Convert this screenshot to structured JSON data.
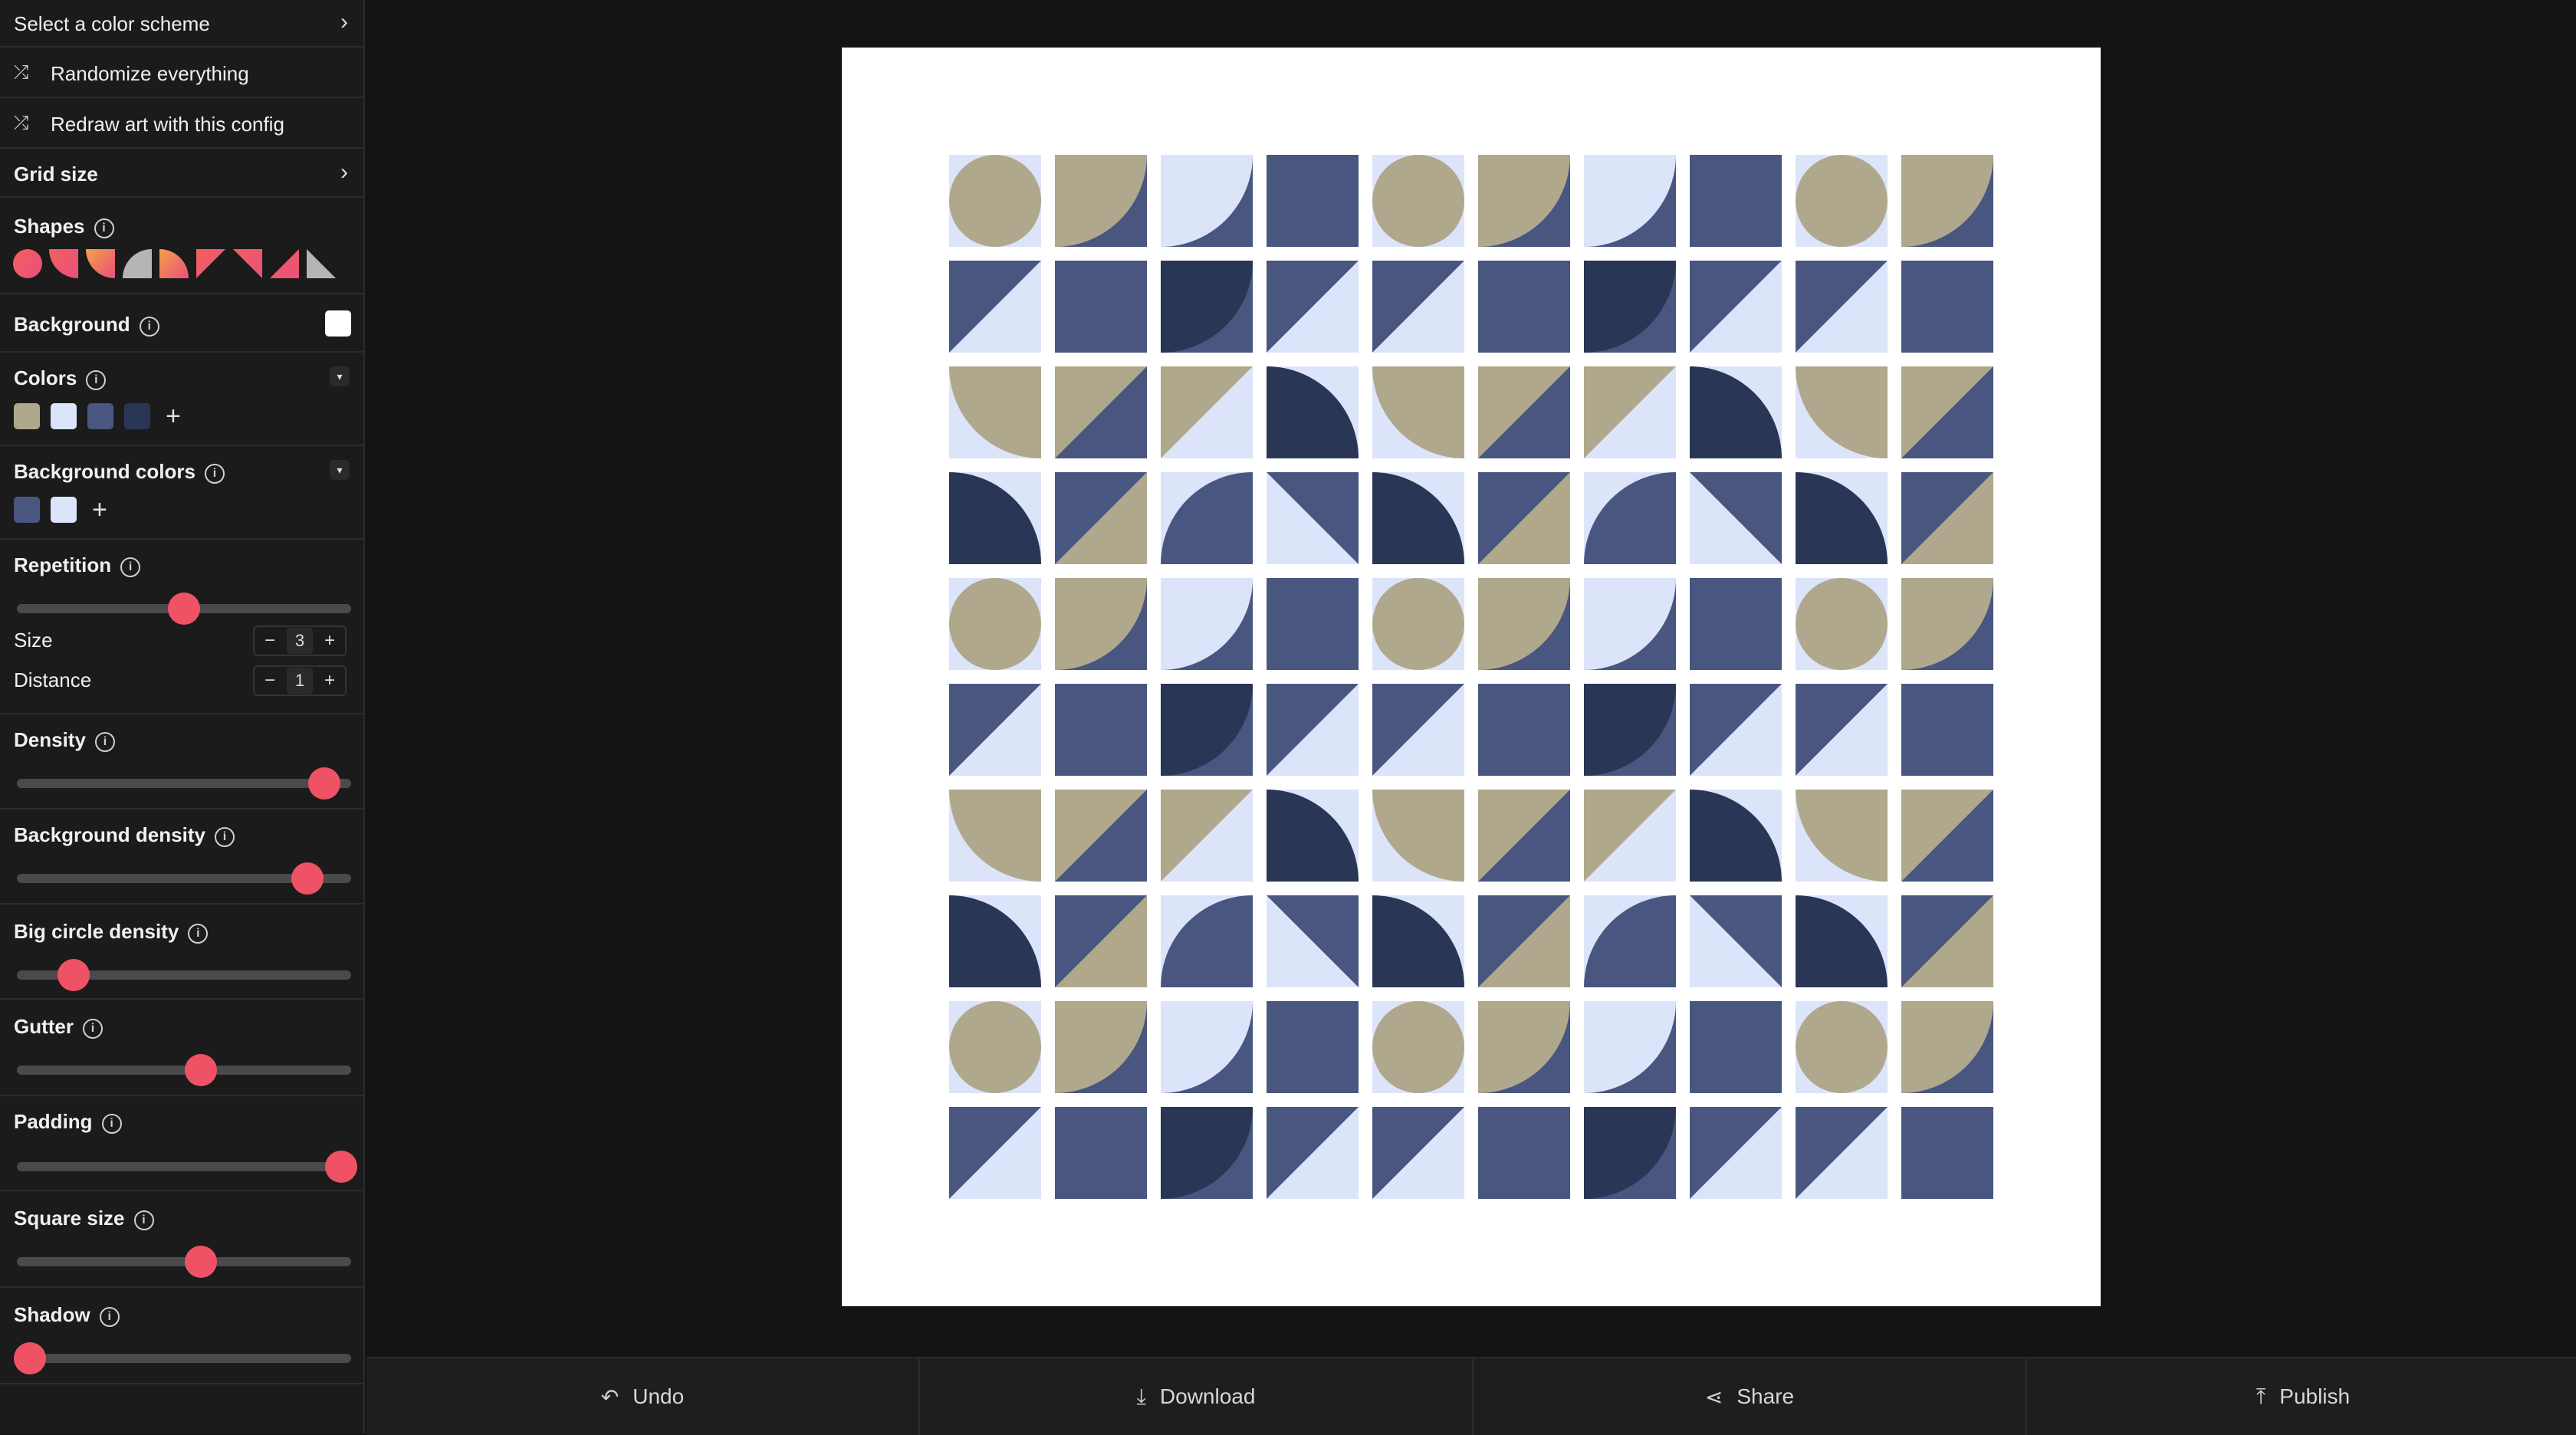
{
  "sidebar": {
    "color_scheme_label": "Select a color scheme",
    "randomize_label": "Randomize everything",
    "redraw_label": "Redraw art with this config",
    "grid_size_label": "Grid size",
    "shapes_label": "Shapes",
    "background_label": "Background",
    "background_color": "#ffffff",
    "colors_label": "Colors",
    "colors": [
      "#b0a88c",
      "#dce4fa",
      "#485680",
      "#2a3656"
    ],
    "background_colors_label": "Background colors",
    "background_colors": [
      "#485680",
      "#dce4fa"
    ],
    "repetition_label": "Repetition",
    "repetition_value": 0.5,
    "size_label": "Size",
    "size_value": "3",
    "distance_label": "Distance",
    "distance_value": "1",
    "density_label": "Density",
    "density_value": 0.92,
    "background_density_label": "Background density",
    "background_density_value": 0.87,
    "big_circle_density_label": "Big circle density",
    "big_circle_density_value": 0.17,
    "gutter_label": "Gutter",
    "gutter_value": 0.55,
    "padding_label": "Padding",
    "padding_value": 0.97,
    "square_size_label": "Square size",
    "square_size_value": 0.55,
    "shadow_label": "Shadow",
    "shadow_value": 0.04,
    "accent_color": "#ef5265"
  },
  "bottom_bar": {
    "undo_label": "Undo",
    "download_label": "Download",
    "share_label": "Share",
    "publish_label": "Publish"
  },
  "art": {
    "palette": {
      "tan": "#b0a88c",
      "light": "#dce4fa",
      "mid": "#485680",
      "dark": "#2a3656"
    },
    "rows": [
      [
        "circle-tan-on-light",
        "q-tan-on-mid-tl",
        "q-light-on-mid-tl",
        "solid-mid",
        "circle-tan-on-light",
        "q-tan-on-mid-tl",
        "q-light-on-mid-tl",
        "solid-mid",
        "circle-tan-on-light",
        "q-tan-on-mid-tl"
      ],
      [
        "tri-mid-on-light",
        "solid-mid",
        "q-dark-on-mid-tl",
        "tri-mid-on-light",
        "tri-mid-on-light",
        "solid-mid",
        "q-dark-on-mid-tl",
        "tri-mid-on-light",
        "tri-mid-on-light",
        "solid-mid"
      ],
      [
        "q-tan-on-light-tr",
        "tri-tan-on-mid",
        "tri-tan-on-light",
        "q-dark-on-light-bl",
        "q-tan-on-light-tr",
        "tri-tan-on-mid",
        "tri-tan-on-light",
        "q-dark-on-light-bl",
        "q-tan-on-light-tr",
        "tri-tan-on-mid"
      ],
      [
        "q-dark-on-light-bl",
        "tri-mid-on-tan",
        "q-mid-on-light-br",
        "tri2-mid-on-light",
        "q-dark-on-light-bl",
        "tri-mid-on-tan",
        "q-mid-on-light-br",
        "tri2-mid-on-light",
        "q-dark-on-light-bl",
        "tri-mid-on-tan"
      ],
      [
        "circle-tan-on-light",
        "q-tan-on-mid-tl",
        "q-light-on-mid-tl",
        "solid-mid",
        "circle-tan-on-light",
        "q-tan-on-mid-tl",
        "q-light-on-mid-tl",
        "solid-mid",
        "circle-tan-on-light",
        "q-tan-on-mid-tl"
      ],
      [
        "tri-mid-on-light",
        "solid-mid",
        "q-dark-on-mid-tl",
        "tri-mid-on-light",
        "tri-mid-on-light",
        "solid-mid",
        "q-dark-on-mid-tl",
        "tri-mid-on-light",
        "tri-mid-on-light",
        "solid-mid"
      ],
      [
        "q-tan-on-light-tr",
        "tri-tan-on-mid",
        "tri-tan-on-light",
        "q-dark-on-light-bl",
        "q-tan-on-light-tr",
        "tri-tan-on-mid",
        "tri-tan-on-light",
        "q-dark-on-light-bl",
        "q-tan-on-light-tr",
        "tri-tan-on-mid"
      ],
      [
        "q-dark-on-light-bl",
        "tri-mid-on-tan",
        "q-mid-on-light-br",
        "tri2-mid-on-light",
        "q-dark-on-light-bl",
        "tri-mid-on-tan",
        "q-mid-on-light-br",
        "tri2-mid-on-light",
        "q-dark-on-light-bl",
        "tri-mid-on-tan"
      ],
      [
        "circle-tan-on-light",
        "q-tan-on-mid-tl",
        "q-light-on-mid-tl",
        "solid-mid",
        "circle-tan-on-light",
        "q-tan-on-mid-tl",
        "q-light-on-mid-tl",
        "solid-mid",
        "circle-tan-on-light",
        "q-tan-on-mid-tl"
      ],
      [
        "tri-mid-on-light",
        "solid-mid",
        "q-dark-on-mid-tl",
        "tri-mid-on-light",
        "tri-mid-on-light",
        "solid-mid",
        "q-dark-on-mid-tl",
        "tri-mid-on-light",
        "tri-mid-on-light",
        "solid-mid"
      ]
    ]
  }
}
